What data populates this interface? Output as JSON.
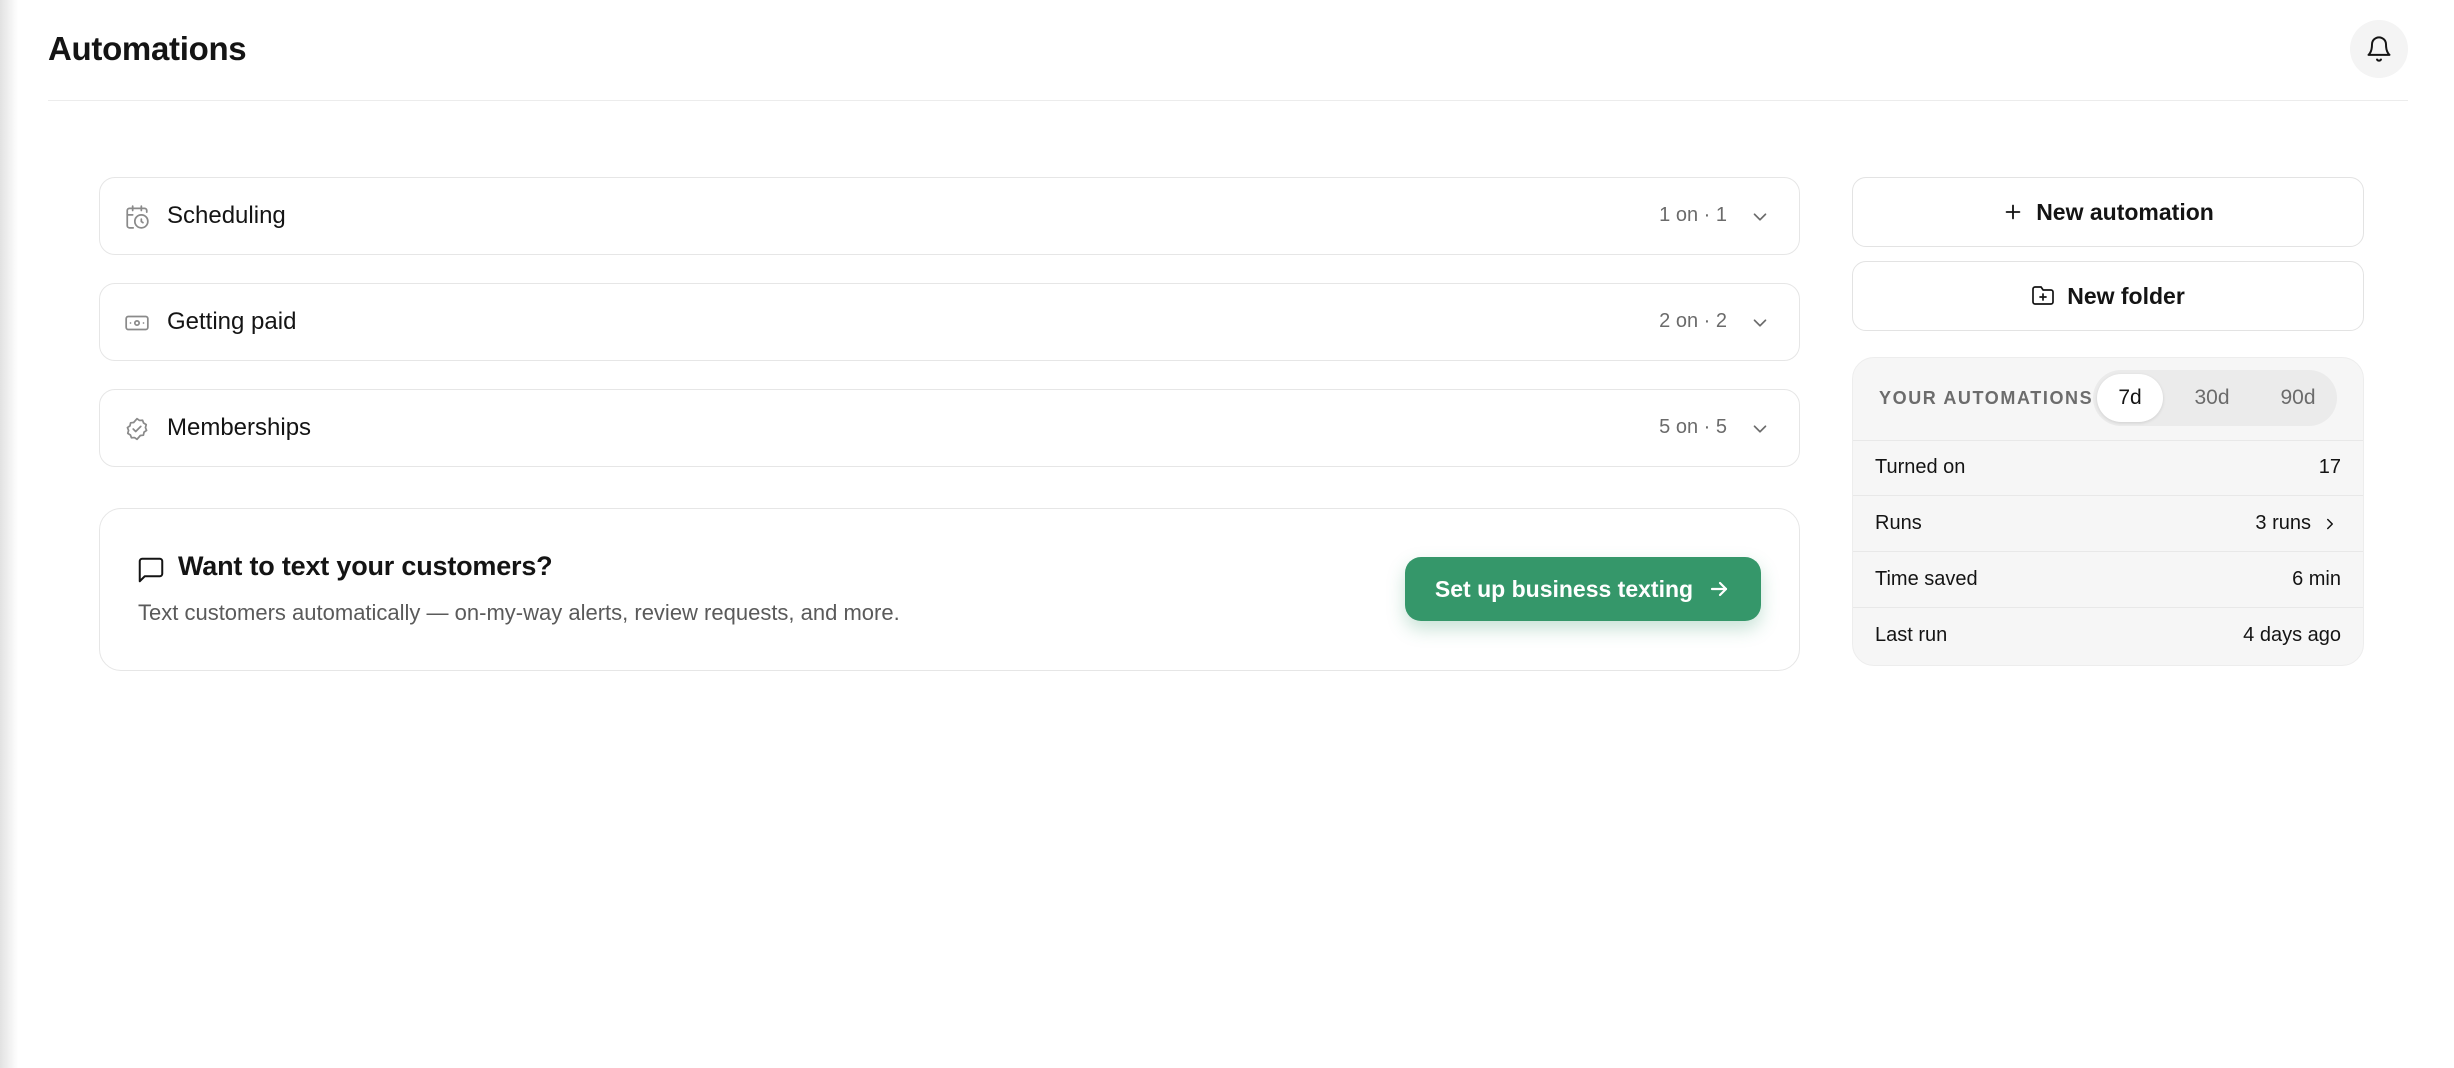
{
  "header": {
    "title": "Automations",
    "notifications_icon": "bell-icon"
  },
  "categories": [
    {
      "label": "Scheduling",
      "count": "1 on · 1",
      "icon": "calendar-clock-icon"
    },
    {
      "label": "Getting paid",
      "count": "2 on · 2",
      "icon": "cash-icon"
    },
    {
      "label": "Memberships",
      "count": "5 on · 5",
      "icon": "badge-check-icon"
    }
  ],
  "promo": {
    "title": "Want to text your customers?",
    "subtitle": "Text customers automatically — on-my-way alerts, review requests, and more.",
    "cta_label": "Set up business texting",
    "icon": "message-square-icon"
  },
  "sidebar": {
    "new_automation_label": "New automation",
    "new_folder_label": "New folder",
    "stats": {
      "heading": "YOUR AUTOMATIONS",
      "ranges": [
        "7d",
        "30d",
        "90d"
      ],
      "selected_range": "7d",
      "rows": [
        {
          "label": "Turned on",
          "value": "17"
        },
        {
          "label": "Runs",
          "value": "3 runs"
        },
        {
          "label": "Time saved",
          "value": "6 min"
        },
        {
          "label": "Last run",
          "value": "4 days ago"
        }
      ]
    }
  },
  "colors": {
    "accent": "#35976a",
    "text": "#141414",
    "muted": "#6b6b6b",
    "border": "#e6e6e6",
    "panel": "#f6f6f6"
  }
}
